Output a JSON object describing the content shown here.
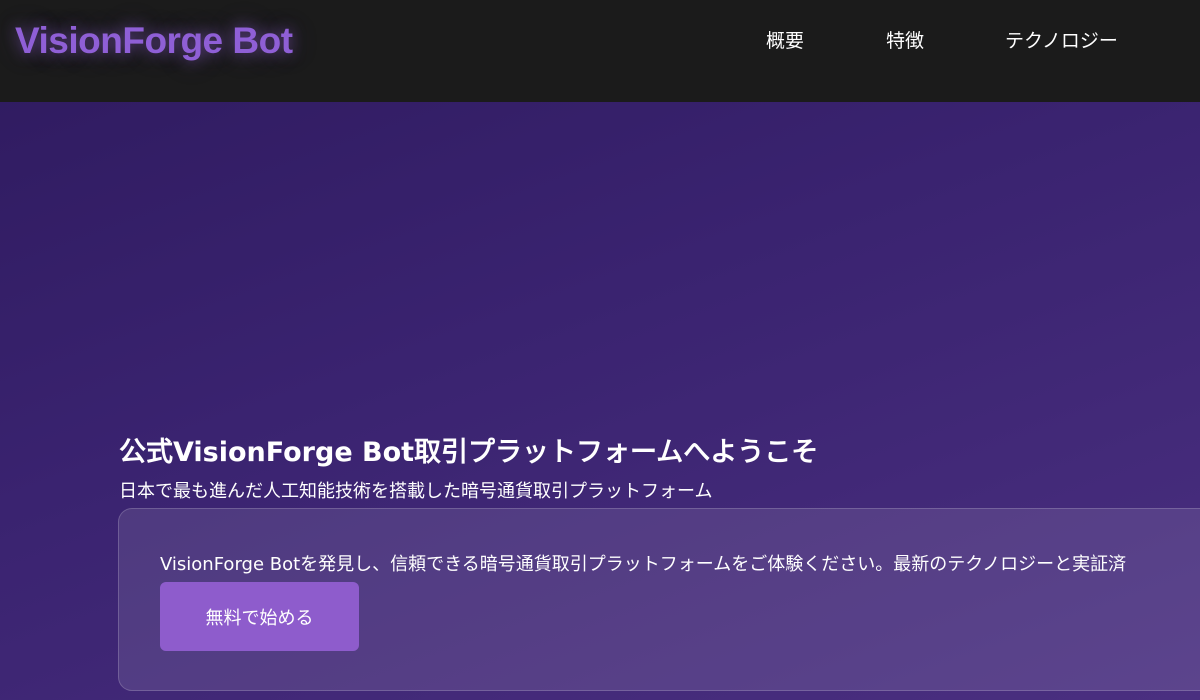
{
  "header": {
    "brand": "VisionForge Bot",
    "nav": [
      {
        "label": "概要"
      },
      {
        "label": "特徴"
      },
      {
        "label": "テクノロジー"
      }
    ]
  },
  "hero": {
    "title": "公式VisionForge Bot取引プラットフォームへようこそ",
    "subtitle": "日本で最も進んだ人工知能技術を搭載した暗号通貨取引プラットフォーム"
  },
  "card": {
    "text": "VisionForge Botを発見し、信頼できる暗号通貨取引プラットフォームをご体験ください。最新のテクノロジーと実証済",
    "cta_label": "無料で始める"
  },
  "colors": {
    "brand": "#8f5fd6",
    "header_bg": "#1b1b1b",
    "cta_bg": "#8e5ccc",
    "page_bg": "#3a2370"
  }
}
